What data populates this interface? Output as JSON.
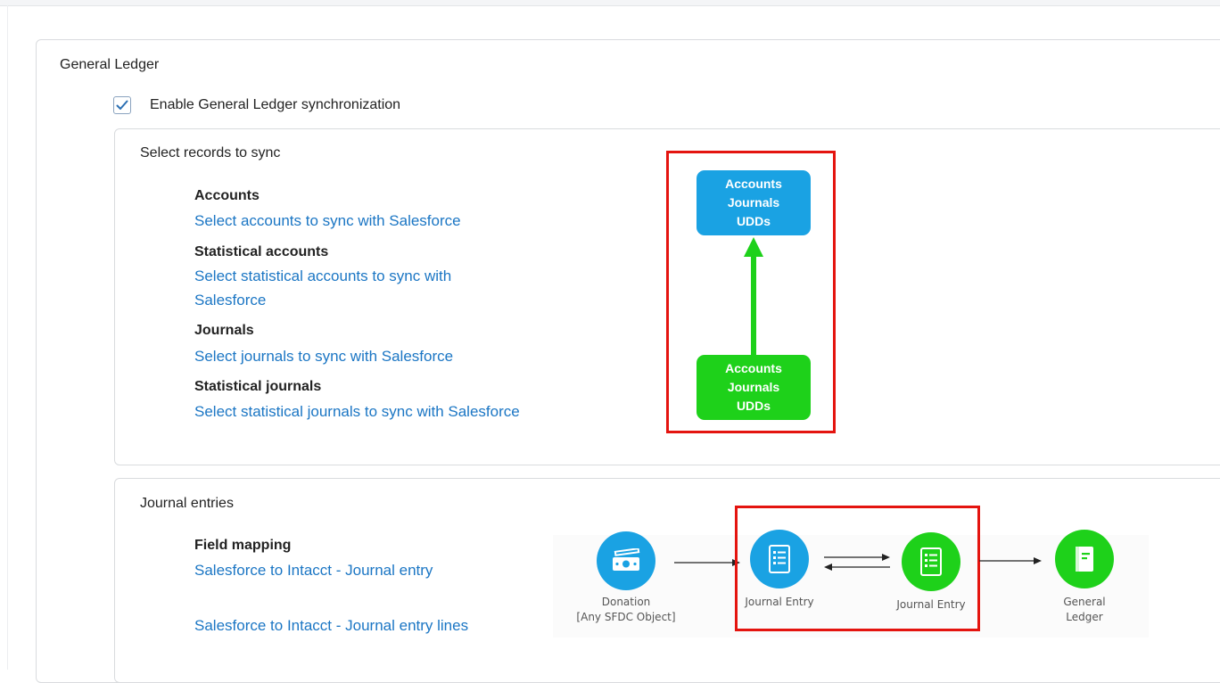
{
  "general_ledger": {
    "title": "General Ledger",
    "enable_label": "Enable General Ledger synchronization",
    "enabled": true
  },
  "select_records": {
    "title": "Select records to sync",
    "groups": [
      {
        "label": "Accounts",
        "link": "Select accounts to sync with Salesforce"
      },
      {
        "label": "Statistical accounts",
        "link_line1": "Select statistical accounts to sync with",
        "link_line2": "Salesforce"
      },
      {
        "label": "Journals",
        "link": "Select journals to sync with Salesforce"
      },
      {
        "label": "Statistical journals",
        "link": "Select statistical journals to sync with Salesforce"
      }
    ],
    "diagram": {
      "top_node": [
        "Accounts",
        "Journals",
        "UDDs"
      ],
      "bottom_node": [
        "Accounts",
        "Journals",
        "UDDs"
      ],
      "colors": {
        "top": "#1aa2e3",
        "bottom": "#1ed11a",
        "arrow": "#1ed11a",
        "highlight": "#e4140f"
      }
    }
  },
  "journal_entries": {
    "title": "Journal entries",
    "field_mapping_label": "Field mapping",
    "links": [
      "Salesforce to Intacct - Journal entry",
      "Salesforce to Intacct - Journal entry lines"
    ],
    "flow": {
      "nodes": [
        {
          "icon": "money-icon",
          "caption_line1": "Donation",
          "caption_line2": "[Any SFDC Object]",
          "color": "#1aa2e3"
        },
        {
          "icon": "document-list-icon",
          "caption_line1": "Journal Entry",
          "color": "#1aa2e3"
        },
        {
          "icon": "document-list-icon",
          "caption_line1": "Journal Entry",
          "color": "#1ed11a"
        },
        {
          "icon": "ledger-book-icon",
          "caption_line1": "General",
          "caption_line2": "Ledger",
          "color": "#1ed11a"
        }
      ]
    }
  }
}
